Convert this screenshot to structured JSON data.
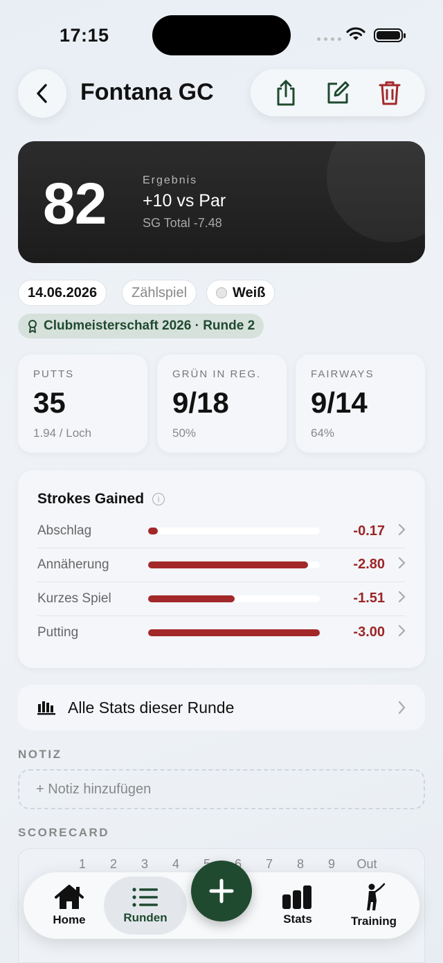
{
  "status": {
    "time": "17:15"
  },
  "header": {
    "title": "Fontana GC",
    "back_icon": "chevron-left-icon",
    "actions": [
      "share-icon",
      "edit-icon",
      "trash-icon"
    ]
  },
  "score": {
    "value": "82",
    "label": "Ergebnis",
    "vs_par": "+10 vs Par",
    "sg_total": "SG Total -7.48"
  },
  "chips": {
    "date": "14.06.2026",
    "type": "Zählspiel",
    "tee": "Weiß",
    "event": "Clubmeisterschaft 2026 · Runde 2"
  },
  "stats": [
    {
      "title": "PUTTS",
      "value": "35",
      "sub": "1.94 / Loch"
    },
    {
      "title": "GRÜN IN REG.",
      "value": "9/18",
      "sub": "50%"
    },
    {
      "title": "FAIRWAYS",
      "value": "9/14",
      "sub": "64%"
    }
  ],
  "strokes_gained": {
    "title": "Strokes Gained",
    "rows": [
      {
        "label": "Abschlag",
        "value": "-0.17",
        "fraction": 0.057
      },
      {
        "label": "Annäherung",
        "value": "-2.80",
        "fraction": 0.933
      },
      {
        "label": "Kurzes Spiel",
        "value": "-1.51",
        "fraction": 0.503
      },
      {
        "label": "Putting",
        "value": "-3.00",
        "fraction": 1.0
      }
    ]
  },
  "all_stats": {
    "label": "Alle Stats dieser Runde"
  },
  "note": {
    "section": "NOTIZ",
    "placeholder": "+ Notiz hinzufügen"
  },
  "scorecard": {
    "section": "SCORECARD",
    "holes": [
      "1",
      "2",
      "3",
      "4",
      "5",
      "6",
      "7",
      "8",
      "9",
      "Out"
    ]
  },
  "tabs": [
    {
      "label": "Home",
      "icon": "house-icon"
    },
    {
      "label": "Runden",
      "icon": "list-icon",
      "active": true
    },
    {
      "label": "Stats",
      "icon": "bar-chart-icon"
    },
    {
      "label": "Training",
      "icon": "golfer-icon"
    }
  ],
  "colors": {
    "accent": "#1f4a2f",
    "negative": "#a3282a",
    "dark_card": "#232323"
  }
}
